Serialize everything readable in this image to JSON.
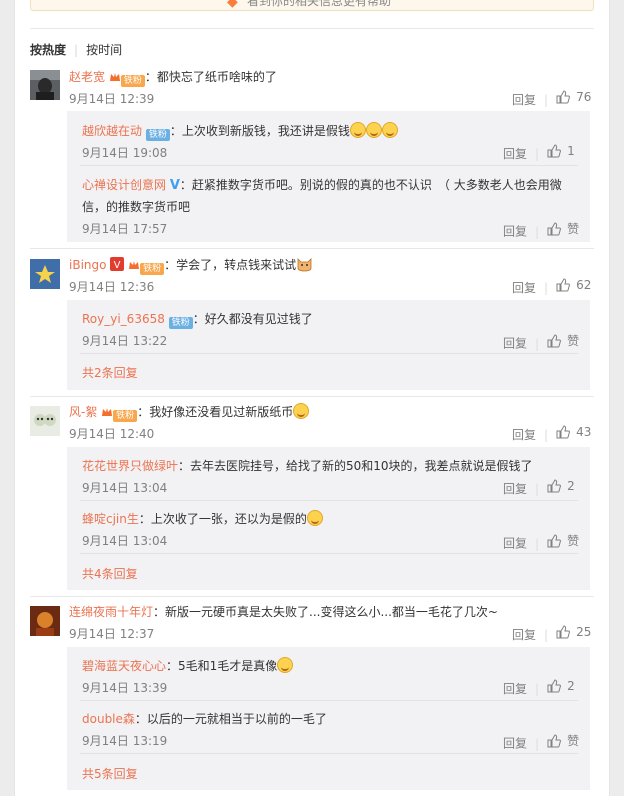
{
  "top_bar": {
    "text": "看到你的相关信息更有帮助"
  },
  "sort": {
    "hot": "按热度",
    "divider": "|",
    "time": "按时间"
  },
  "actions": {
    "reply": "回复",
    "like_zero": "赞"
  },
  "badges": {
    "fan": "铁粉"
  },
  "comments": [
    {
      "user": "赵老宽",
      "text": "：都快忘了纸币啥味的了",
      "time": "9月14日 12:39",
      "likes": "76",
      "replies": [
        {
          "user": "越欣越在动",
          "text": "：上次收到新版钱，我还讲是假钱",
          "time": "9月14日 19:08",
          "likes": "1"
        },
        {
          "user": "心禅设计创意网",
          "text": "：赶紧推数字货币吧。别说的假的真的也不认识　（ 大多数老人也会用微",
          "text2": "信，的推数字货币吧",
          "time": "9月14日 17:57",
          "likes": "赞"
        }
      ]
    },
    {
      "user": "iBingo",
      "text": "：学会了，转点钱来试试",
      "time": "9月14日 12:36",
      "likes": "62",
      "replies": [
        {
          "user": "Roy_yi_63658",
          "text": "：好久都没有见过钱了",
          "time": "9月14日 13:22",
          "likes": "赞"
        }
      ],
      "more": "共2条回复"
    },
    {
      "user": "风-絮",
      "text": "：我好像还没看见过新版纸币",
      "time": "9月14日 12:40",
      "likes": "43",
      "replies": [
        {
          "user": "花花世界只做绿叶",
          "text": "：去年去医院挂号，给找了新的50和10块的，我差点就说是假钱了",
          "time": "9月14日 13:04",
          "likes": "2"
        },
        {
          "user": "蜂啶cjin生",
          "text": "：上次收了一张，还以为是假的",
          "time": "9月14日 13:04",
          "likes": "赞"
        }
      ],
      "more": "共4条回复"
    },
    {
      "user": "连绵夜雨十年灯",
      "text": "：新版一元硬币真是太失败了...变得这么小...都当一毛花了几次~",
      "time": "9月14日 12:37",
      "likes": "25",
      "replies": [
        {
          "user": "碧海蓝天夜心心",
          "text": "：5毛和1毛才是真像",
          "time": "9月14日 13:39",
          "likes": "2"
        },
        {
          "user": "double森",
          "text": "：以后的一元就相当于以前的一毛了",
          "time": "9月14日 13:19",
          "likes": "赞"
        }
      ],
      "more": "共5条回复"
    }
  ]
}
